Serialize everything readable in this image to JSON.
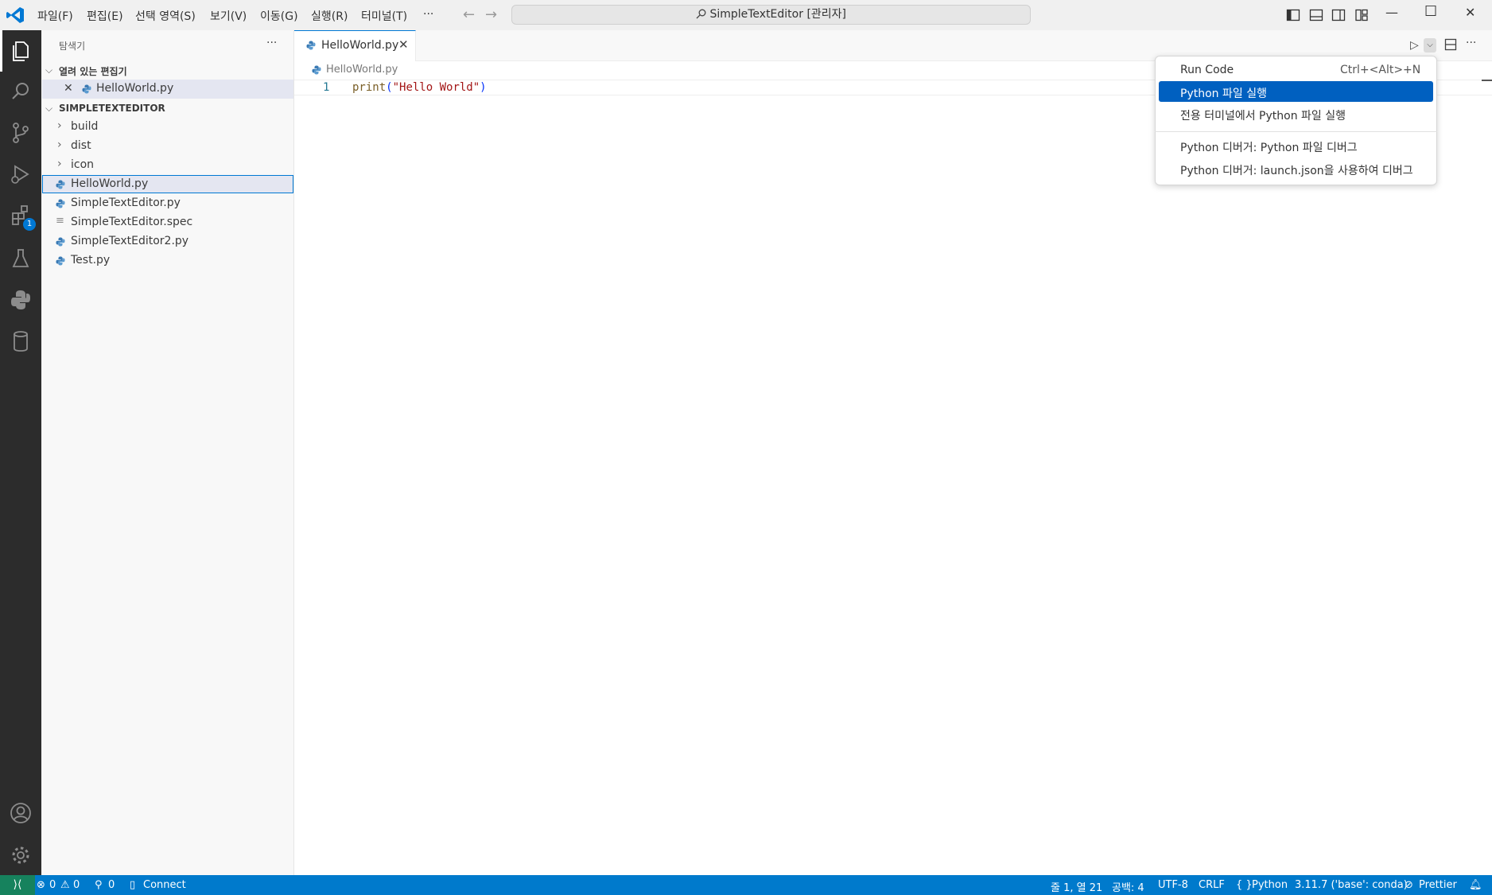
{
  "titlebar": {
    "menus": [
      "파일(F)",
      "편집(E)",
      "선택 영역(S)",
      "보기(V)",
      "이동(G)",
      "실행(R)",
      "터미널(T)",
      "···"
    ],
    "command_center": "SimpleTextEditor [관리자]",
    "nav_back": "←",
    "nav_forward": "→",
    "window_minimize": "—",
    "window_maximize": "☐",
    "window_close": "✕"
  },
  "activity_bar": {
    "extensions_badge": "1"
  },
  "sidebar": {
    "title": "탐색기",
    "more": "···",
    "open_editors_header": "열려 있는 편집기",
    "open_editors": [
      {
        "label": "HelloWorld.py"
      }
    ],
    "project_header": "SIMPLETEXTEDITOR",
    "folders": [
      "build",
      "dist",
      "icon"
    ],
    "files": [
      "HelloWorld.py",
      "SimpleTextEditor.py",
      "SimpleTextEditor.spec",
      "SimpleTextEditor2.py",
      "Test.py"
    ]
  },
  "editor": {
    "tab_label": "HelloWorld.py",
    "breadcrumb": "HelloWorld.py",
    "line_number": "1",
    "code": {
      "fn": "print",
      "open": "(",
      "str": "\"Hello World\"",
      "close": ")"
    },
    "more": "···"
  },
  "run_menu": {
    "items": [
      {
        "label": "Run Code",
        "shortcut": "Ctrl+<Alt>+N"
      },
      {
        "label": "Python 파일 실행",
        "shortcut": ""
      },
      {
        "label": "전용 터미널에서 Python 파일 실행",
        "shortcut": ""
      },
      {
        "label": "Python 디버거: Python 파일 디버그",
        "shortcut": ""
      },
      {
        "label": "Python 디버거: launch.json을 사용하여 디버그",
        "shortcut": ""
      }
    ],
    "highlighted_index": 1
  },
  "statusbar": {
    "errors": "0",
    "warnings": "0",
    "ports": "0",
    "connect": "Connect",
    "position": "줄 1, 열 21",
    "spaces": "공백: 4",
    "encoding": "UTF-8",
    "eol": "CRLF",
    "language": "Python",
    "interpreter": "3.11.7 ('base': conda)",
    "prettier": "Prettier"
  },
  "colors": {
    "accent": "#0078d4",
    "statusbar": "#007acc",
    "menu_highlight": "#0060c0",
    "activitybar": "#2c2c2c"
  }
}
